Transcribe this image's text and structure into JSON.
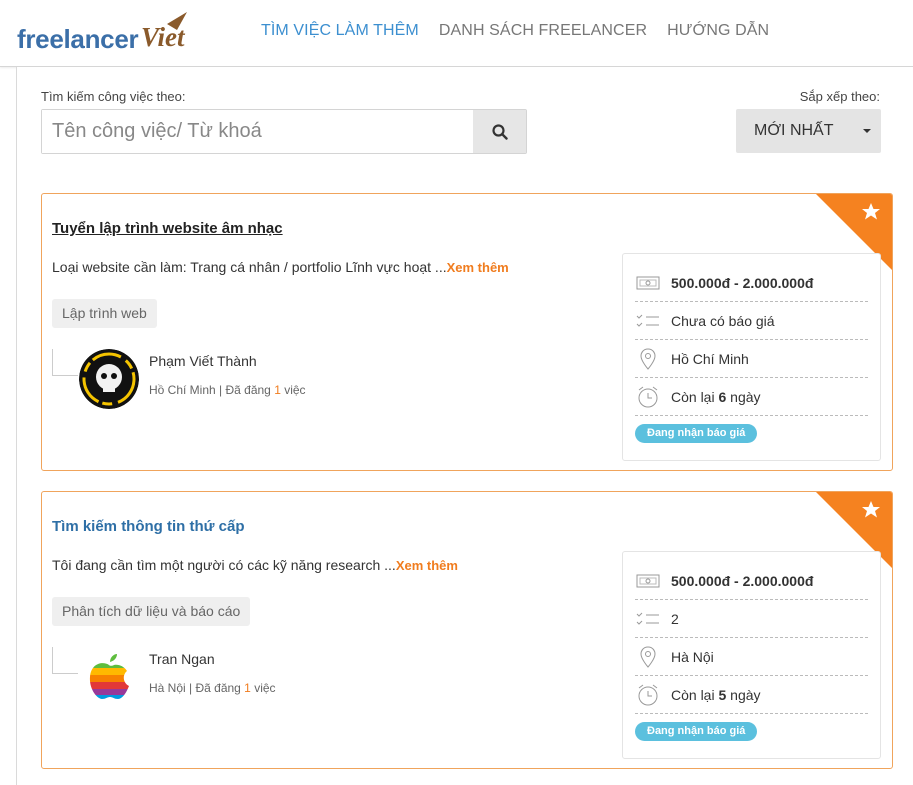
{
  "header": {
    "logo_text": "freelancer",
    "logo_viet": "Viet",
    "nav": [
      {
        "label": "TÌM VIỆC LÀM THÊM",
        "active": true
      },
      {
        "label": "DANH SÁCH FREELANCER",
        "active": false
      },
      {
        "label": "HƯỚNG DẪN",
        "active": false
      }
    ]
  },
  "search": {
    "label": "Tìm kiếm công việc theo:",
    "placeholder": "Tên công việc/ Từ khoá",
    "button_icon": "search-icon"
  },
  "sort": {
    "label": "Sắp xếp theo:",
    "selected": "MỚI NHẤT"
  },
  "jobs": [
    {
      "title": "Tuyển lập trình website âm nhạc",
      "description": "Loại website cần làm: Trang cá nhân / portfolio Lĩnh vực hoạt ...",
      "more": "Xem thêm",
      "tag": "Lập trình web",
      "owner": "Phạm Viết Thành",
      "owner_location": "Hồ Chí Minh | Đã đăng ",
      "owner_count": "1",
      "owner_suffix": " việc",
      "budget": "500.000đ - 2.000.000đ",
      "bids": "Chưa có báo giá",
      "location": "Hồ Chí Minh",
      "remaining_prefix": "Còn lại ",
      "remaining_days": "6",
      "remaining_suffix": " ngày",
      "status": "Đang nhận báo giá"
    },
    {
      "title": "Tìm kiếm thông tin thứ cấp",
      "description": "Tôi đang cần tìm một người có các kỹ năng research ...",
      "more": "Xem thêm",
      "tag": "Phân tích dữ liệu và báo cáo",
      "owner": "Tran Ngan",
      "owner_location": "Hà Nội | Đã đăng ",
      "owner_count": "1",
      "owner_suffix": " việc",
      "budget": "500.000đ - 2.000.000đ",
      "bids": "2",
      "location": "Hà Nội",
      "remaining_prefix": "Còn lại ",
      "remaining_days": "5",
      "remaining_suffix": " ngày",
      "status": "Đang nhận báo giá"
    }
  ],
  "colors": {
    "accent_blue": "#3c8fd0",
    "card_border": "#f0a45c",
    "corner_orange": "#f58220",
    "more_orange": "#f07c1e",
    "badge": "#5bc0de"
  }
}
